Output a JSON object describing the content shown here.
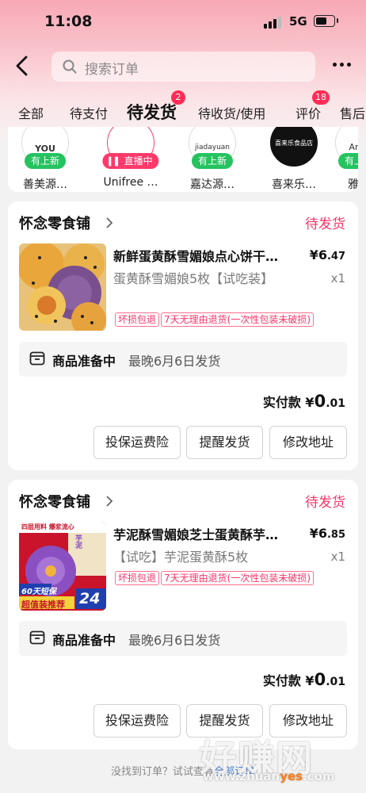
{
  "status_bar": {
    "time": "11:08",
    "network": "5G"
  },
  "header": {
    "search_placeholder": "搜索订单",
    "back_icon": "chevron-left-icon",
    "more_icon": "more-icon"
  },
  "tabs": [
    {
      "label": "全部"
    },
    {
      "label": "待支付"
    },
    {
      "label": "待发货",
      "badge": "2",
      "active": true
    },
    {
      "label": "待收货/使用"
    },
    {
      "label": "评价",
      "badge": "18"
    },
    {
      "label": "售后"
    }
  ],
  "shops": [
    {
      "logo_text": "YOU",
      "tag": "有上新",
      "name": "善美源…"
    },
    {
      "logo_text": "",
      "tag": "直播中",
      "name": "Unifree …"
    },
    {
      "logo_text": "jiadayuan",
      "tag": "有上新",
      "name": "嘉达源…"
    },
    {
      "logo_text": "喜来乐食品店",
      "tag": "",
      "name": "喜来乐…"
    },
    {
      "logo_text": "Ame",
      "tag": "有上新",
      "name": "雅禾"
    }
  ],
  "orders": [
    {
      "store": "怀念零食铺",
      "status": "待发货",
      "product_title": "新鲜蛋黄酥雪媚娘点心饼干…",
      "price_int": "¥6",
      "price_dec": ".47",
      "spec": "蛋黄酥雪媚娘5枚【试吃装】",
      "qty": "x1",
      "tags": [
        "坏损包退",
        "7天无理由退货(一次性包装未破损)"
      ],
      "prep_label": "商品准备中",
      "prep_detail": "最晚6月6日发货",
      "paid_label": "实付款",
      "paid_currency": "¥",
      "paid_int": "0",
      "paid_dec": ".01",
      "buttons": [
        "投保运费险",
        "提醒发货",
        "修改地址"
      ]
    },
    {
      "store": "怀念零食铺",
      "status": "待发货",
      "product_title": "芋泥酥雪媚娘芝士蛋黄酥芋…",
      "price_int": "¥6",
      "price_dec": ".85",
      "spec": "【试吃】芋泥蛋黄酥5枚",
      "qty": "x1",
      "tags": [
        "坏损包退",
        "7天无理由退货(一次性包装未破损)"
      ],
      "image_text": [
        "四层用料 爆浆流心",
        "60天短保",
        "超值装推荐",
        "24",
        "芋泥"
      ],
      "prep_label": "商品准备中",
      "prep_detail": "最晚6月6日发货",
      "paid_label": "实付款",
      "paid_currency": "¥",
      "paid_int": "0",
      "paid_dec": ".01",
      "buttons": [
        "投保运费险",
        "提醒发货",
        "修改地址"
      ]
    }
  ],
  "footer": {
    "text": "没找到订单？试试查看",
    "link": "全部订单"
  },
  "watermark": {
    "text": "好赚网",
    "url_a": "www.zhuan",
    "url_b": "yes",
    "url_c": ".com"
  },
  "colors": {
    "accent": "#ff3366",
    "badge": "#ff2d55",
    "green_tag": "#25c35f"
  }
}
